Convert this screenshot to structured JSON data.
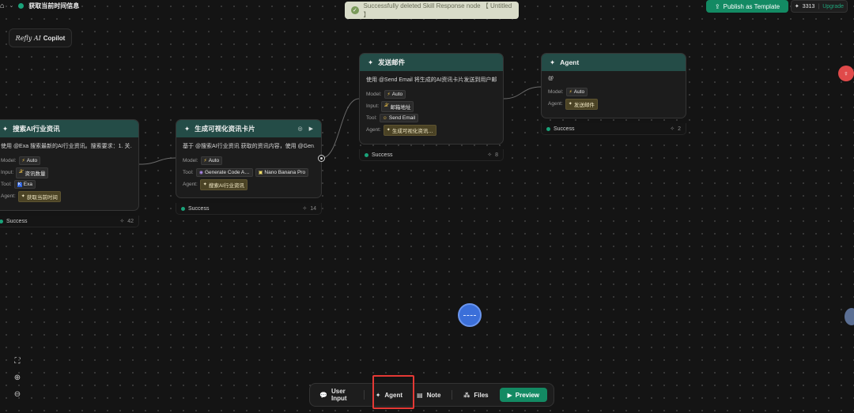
{
  "topbar": {
    "title": "获取当前时间信息",
    "toast": "Successfully deleted Skill Response node 【 Untitled 】",
    "publish_label": "Publish as Template",
    "credits": "3313",
    "upgrade_label": "Upgrade"
  },
  "brand": {
    "italic": "Refly AI",
    "label": "Copilot"
  },
  "labels": {
    "model": "Model:",
    "input": "Input:",
    "tool": "Tool:",
    "agent": "Agent:"
  },
  "nodes": [
    {
      "title": "搜索AI行业资讯",
      "desc": "使用 @Exa 搜索最新的AI行业资讯。搜索要求：1. 关…",
      "model": "Auto",
      "input": "资讯数量",
      "tool": "Exa",
      "agent": "获取当前时间",
      "status": "Success",
      "count": "42"
    },
    {
      "title": "生成可视化资讯卡片",
      "desc": "基于 @搜索AI行业资讯 获取的资讯内容，使用 @Gen…",
      "model": "Auto",
      "tool1": "Generate Code A…",
      "tool2": "Nano Banana Pro",
      "agent": "搜索AI行业资讯",
      "status": "Success",
      "count": "14"
    },
    {
      "title": "发送邮件",
      "desc": "使用 @Send Email 将生成的AI资讯卡片发送到用户邮…",
      "model": "Auto",
      "input": "邮箱地址",
      "tool": "Send Email",
      "agent": "生成可视化资讯…",
      "status": "Success",
      "count": "8"
    },
    {
      "title": "Agent",
      "desc": "@",
      "model": "Auto",
      "agent": "发送邮件",
      "status": "Success",
      "count": "2"
    }
  ],
  "toolbar": {
    "user_input": "User Input",
    "agent": "Agent",
    "note": "Note",
    "files": "Files",
    "preview": "Preview"
  }
}
